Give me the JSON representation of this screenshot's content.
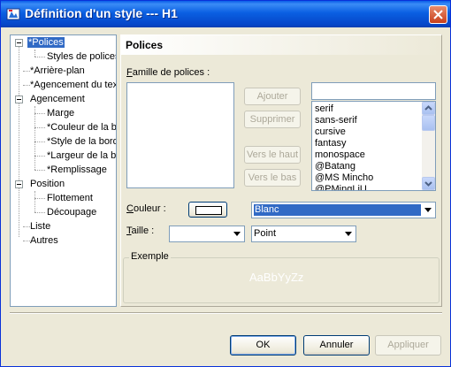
{
  "window": {
    "title": "Définition d'un style --- H1"
  },
  "tree": {
    "items": [
      {
        "label": "*Polices"
      },
      {
        "label": "Styles de polices"
      },
      {
        "label": "*Arrière-plan"
      },
      {
        "label": "*Agencement du tex"
      },
      {
        "label": "Agencement"
      },
      {
        "label": "Marge"
      },
      {
        "label": "*Couleur de la b"
      },
      {
        "label": "*Style de la bord"
      },
      {
        "label": "*Largeur de la b"
      },
      {
        "label": "*Remplissage"
      },
      {
        "label": "Position"
      },
      {
        "label": "Flottement"
      },
      {
        "label": "Découpage"
      },
      {
        "label": "Liste"
      },
      {
        "label": "Autres"
      }
    ]
  },
  "panel": {
    "title": "Polices"
  },
  "font_family": {
    "label_prefix": "F",
    "label_rest": "amille de polices :",
    "input_value": "",
    "options": [
      "serif",
      "sans-serif",
      "cursive",
      "fantasy",
      "monospace",
      "@Batang",
      "@MS Mincho",
      "@PMingLiU"
    ]
  },
  "buttons": {
    "add": "Ajouter",
    "remove": "Supprimer",
    "up": "Vers le haut",
    "down": "Vers le bas",
    "ok": "OK",
    "cancel": "Annuler",
    "apply": "Appliquer"
  },
  "color": {
    "label_prefix": "C",
    "label_rest": "ouleur :",
    "value": "Blanc",
    "swatch": "#ffffff"
  },
  "size": {
    "label_prefix": "T",
    "label_rest": "aille :",
    "value": "",
    "unit": "Point"
  },
  "sample": {
    "label": "Exemple",
    "text": "AaBbYyZz"
  }
}
